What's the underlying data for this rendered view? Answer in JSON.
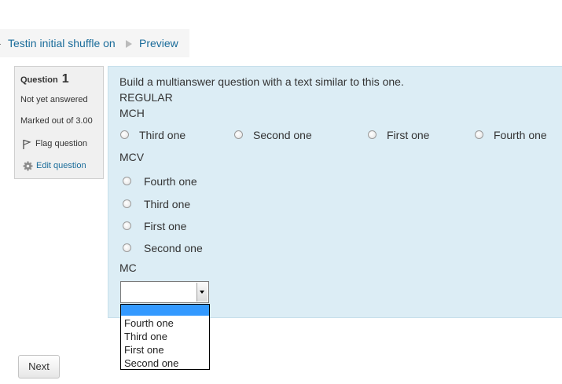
{
  "breadcrumb": {
    "items": [
      "Testin initial shuffle on",
      "Preview"
    ]
  },
  "info": {
    "question_label": "Question",
    "question_number": "1",
    "state": "Not yet answered",
    "grade": "Marked out of 3.00",
    "flag_label": "Flag question",
    "edit_label": "Edit question"
  },
  "question": {
    "intro": "Build a multianswer question with a text similar to this one.",
    "regular": "REGULAR",
    "mch_label": "MCH",
    "mch_options": [
      "Third one",
      "Second one",
      "First one",
      "Fourth one"
    ],
    "mcv_label": "MCV",
    "mcv_options": [
      "Fourth one",
      "Third one",
      "First one",
      "Second one"
    ],
    "mc_label": "MC",
    "mc_selected": "",
    "mc_options": [
      "",
      "Fourth one",
      "Third one",
      "First one",
      "Second one"
    ]
  },
  "nav": {
    "next_label": "Next"
  },
  "colors": {
    "content_bg": "#dcedf5",
    "info_bg": "#f0f0f0",
    "link": "#1a6c9a",
    "dropdown_highlight": "#3399ff"
  }
}
